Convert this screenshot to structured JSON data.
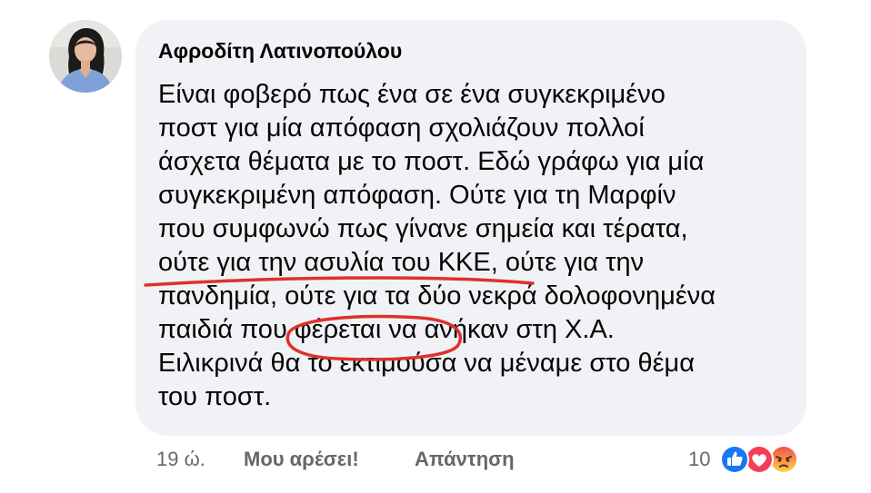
{
  "comment": {
    "author": "Αφροδίτη Λατινοπούλου",
    "text_lines": [
      "Είναι φοβερό πως ένα σε ένα συγκεκριμένο",
      "ποστ για μία απόφαση σχολιάζουν πολλοί",
      "άσχετα θέματα με το ποστ. Εδώ γράφω για μία",
      "συγκεκριμένη απόφαση. Ούτε για τη Μαρφίν",
      "που συμφωνώ πως γίνανε σημεία και τέρατα,",
      "ούτε για την ασυλία του ΚΚΕ, ούτε για την",
      "πανδημία, ούτε για τα δύο νεκρά δολοφονημένα",
      "παιδιά που φέρεται να ανήκαν στη Χ.Α.",
      "Ειλικρινά θα το εκτιμούσα να μέναμε στο θέμα",
      "του ποστ."
    ]
  },
  "footer": {
    "timestamp": "19 ώ.",
    "like_label": "Μου αρέσει!",
    "reply_label": "Απάντηση",
    "reaction_count": "10"
  },
  "reactions": {
    "types": [
      "like-icon",
      "love-icon",
      "angry-icon"
    ],
    "colors": {
      "like": "#1877f2",
      "love": "#f33e58",
      "angry": "#f7714b",
      "annotation_ink": "#e0302a"
    }
  }
}
